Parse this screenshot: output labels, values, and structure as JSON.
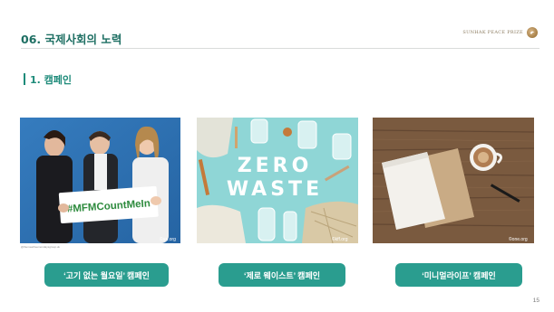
{
  "header": {
    "title": "06. 국제사회의 노력",
    "brand": "SUNHAK PEACE PRIZE"
  },
  "section": {
    "title": "1. 캠페인"
  },
  "campaigns": [
    {
      "button": "‘고기 없는 월요일’ 캠페인",
      "sign_text": "#MFMCountMeIn",
      "credit": "©un.org",
      "small_credit": "@themeatfreemondaysgroup.uk"
    },
    {
      "button": "‘제로 웨이스트’ 캠페인",
      "image_text_line1": "ZERO",
      "image_text_line2": "WASTE",
      "credit": "©kff.org"
    },
    {
      "button": "‘미니멀라이프’ 캠페인",
      "credit": "©one.org"
    }
  ],
  "page_number": "15",
  "colors": {
    "accent": "#1e8b7a",
    "button": "#2a9d8f",
    "title": "#1e6f63"
  }
}
